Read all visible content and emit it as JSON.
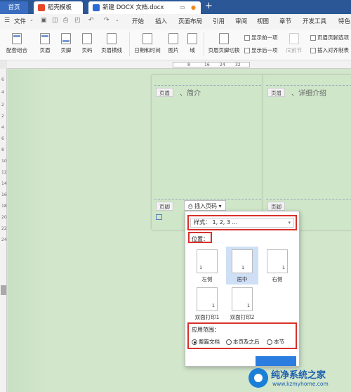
{
  "tabs": {
    "home": "首页",
    "straw": "稻壳模板",
    "doc": "新建 DOCX 文档.docx",
    "new_tab": "+"
  },
  "menu": {
    "file": "文件",
    "items": [
      "开始",
      "插入",
      "页面布局",
      "引用",
      "审阅",
      "视图",
      "章节",
      "开发工具",
      "特色"
    ]
  },
  "ribbon": {
    "combo": "配套组合",
    "header": "页眉",
    "footer": "页脚",
    "pagenum": "页码",
    "headerline": "页眉横线",
    "datetime": "日期和时间",
    "picture": "图片",
    "field": "域",
    "switch": "页眉页脚切换",
    "prev": "显示前一项",
    "next": "显示后一项",
    "samefirst": "同前节",
    "options": "页眉页脚选项",
    "align": "插入对齐制表"
  },
  "ruler": {
    "marks": [
      "8",
      "16",
      "24",
      "32"
    ]
  },
  "vruler": [
    "6",
    "4",
    "2",
    "2",
    "4",
    "6",
    "8",
    "10",
    "12",
    "14",
    "16",
    "18",
    "20",
    "22",
    "24"
  ],
  "pages": {
    "p1_title": "、简介",
    "p2_title": "、详细介绍",
    "header_tag": "页眉",
    "footer_tag": "页脚",
    "insert_pagenum": "插入页码"
  },
  "panel": {
    "style_value": "样式：  1, 2, 3 ...",
    "position_label": "位置：",
    "positions": [
      "左侧",
      "居中",
      "右侧",
      "双面打印1",
      "双面打印2"
    ],
    "range_label": "应用范围：",
    "ranges": [
      "整篇文档",
      "本页及之后",
      "本节"
    ],
    "selected_position": "居中",
    "selected_range": "整篇文档"
  },
  "watermark": {
    "title": "纯净系统之家",
    "url": "www.kzmyhome.com"
  },
  "colors": {
    "tabbar": "#2b5797",
    "canvas": "#d2e6cc",
    "highlight_box": "#d8302b",
    "selected_option": "#cfdff6"
  }
}
